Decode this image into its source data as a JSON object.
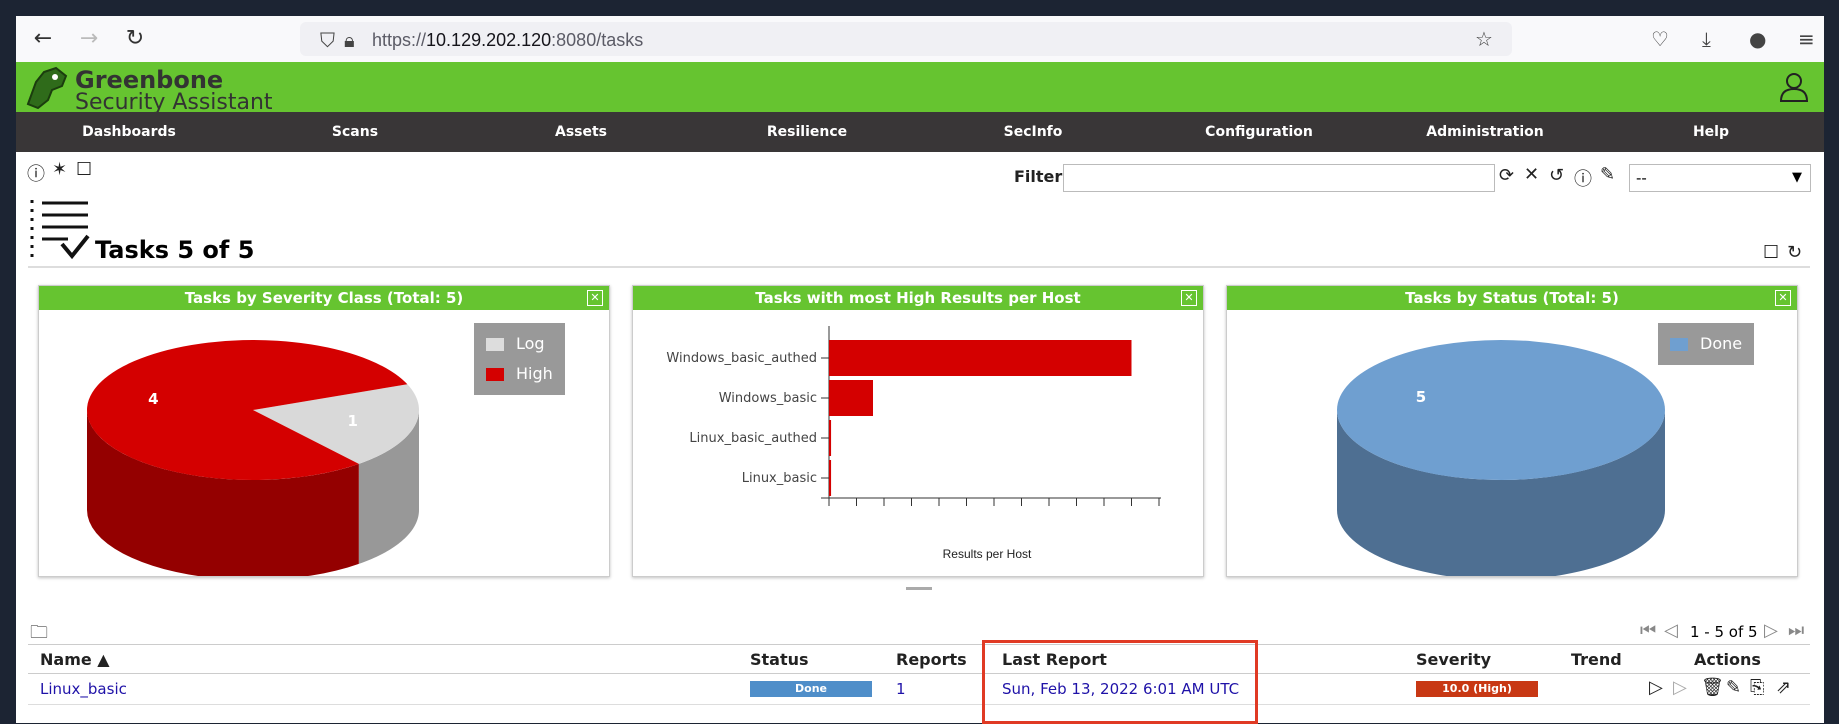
{
  "browser": {
    "url_scheme": "https://",
    "url_host": "10.129.202.120",
    "url_rest": ":8080/tasks"
  },
  "app": {
    "brand_line1": "Greenbone",
    "brand_line2": "Security Assistant"
  },
  "menu": [
    "Dashboards",
    "Scans",
    "Assets",
    "Resilience",
    "SecInfo",
    "Configuration",
    "Administration",
    "Help"
  ],
  "filter": {
    "label": "Filter",
    "value": "",
    "select_value": "--"
  },
  "page": {
    "title": "Tasks 5 of 5"
  },
  "charts_panels": [
    {
      "title": "Tasks by Severity Class (Total: 5)"
    },
    {
      "title": "Tasks with most High Results per Host"
    },
    {
      "title": "Tasks by Status (Total: 5)"
    }
  ],
  "chart_data": [
    {
      "type": "pie",
      "title": "Tasks by Severity Class (Total: 5)",
      "categories": [
        "Log",
        "High"
      ],
      "values": [
        1,
        4
      ],
      "colors": [
        "#d9d9d9",
        "#d40000"
      ],
      "legend": [
        "Log",
        "High"
      ],
      "legend_position": "top-right"
    },
    {
      "type": "bar",
      "orientation": "horizontal",
      "title": "Tasks with most High Results per Host",
      "categories": [
        "Windows_basic_authed",
        "Windows_basic",
        "Linux_basic_authed",
        "Linux_basic"
      ],
      "values": [
        22,
        3.2,
        0.15,
        0.15
      ],
      "xlim": [
        0,
        24
      ],
      "xlabel": "Results per Host",
      "color": "#d40000"
    },
    {
      "type": "pie",
      "title": "Tasks by Status (Total: 5)",
      "categories": [
        "Done"
      ],
      "values": [
        5
      ],
      "colors": [
        "#6f9fd0"
      ],
      "legend": [
        "Done"
      ],
      "legend_position": "top-right"
    }
  ],
  "pagination": {
    "text": "1 - 5 of 5"
  },
  "table": {
    "headers": [
      "Name ▲",
      "Status",
      "Reports",
      "Last Report",
      "Severity",
      "Trend",
      "Actions"
    ],
    "rows": [
      {
        "name": "Linux_basic",
        "status": "Done",
        "reports": "1",
        "last_report": "Sun, Feb 13, 2022 6:01 AM UTC",
        "severity": "10.0 (High)"
      }
    ]
  },
  "colors": {
    "green": "#66c430",
    "menu": "#393637",
    "high": "#d40000",
    "done": "#4f8ec9",
    "severity_badge": "#c83814",
    "highlight": "#e03a24"
  }
}
